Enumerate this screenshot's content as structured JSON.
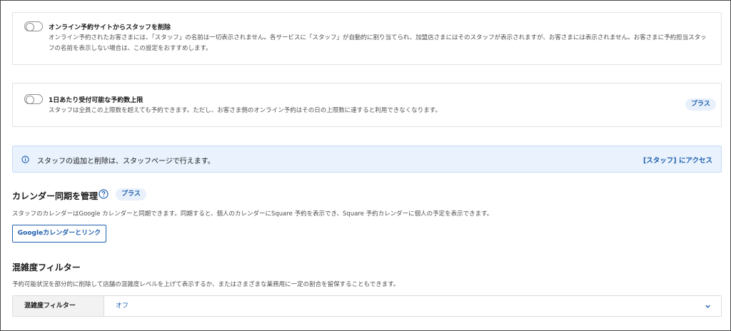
{
  "staff_removal": {
    "title": "オンライン予約サイトからスタッフを削除",
    "description": "オンライン予約されたお客さまには、「スタッフ」の名前は一切表示されません。各サービスに「スタッフ」が自動的に割り当てられ、加盟店さまにはそのスタッフが表示されますが、お客さまには表示されません。お客さまに予約担当スタッフの名前を表示しない場合は、この設定をおすすめします。"
  },
  "daily_limit": {
    "title": "1日あたり受付可能な予約数上限",
    "description": "スタッフは全員この上限数を超えても予約できます。ただし、お客さま側のオンライン予約はその日の上限数に達すると利用できなくなります。",
    "badge": "プラス"
  },
  "info_banner": {
    "text": "スタッフの追加と削除は、スタッフページで行えます。",
    "link": "[スタッフ] にアクセス"
  },
  "calendar_sync": {
    "title": "カレンダー同期を管理",
    "badge": "プラス",
    "description": "スタッフのカレンダーはGoogle カレンダーと同期できます。同期すると、個人のカレンダーにSquare 予約を表示でき、Square 予約カレンダーに個人の予定を表示できます。",
    "button": "Googleカレンダーとリンク"
  },
  "congestion_filter": {
    "title": "混雑度フィルター",
    "description": "予約可能状況を部分的に削除して店舗の混雑度レベルを上げて表示するか、またはさまざまな業務用に一定の割合を留保することもできます。",
    "label": "混雑度フィルター",
    "value": "オフ"
  },
  "colors": {
    "accent": "#1f5fae",
    "banner_bg": "#e9f2fd",
    "badge_bg": "#e8f0fb"
  },
  "icons": [
    "info-icon",
    "help-icon",
    "chevron-down-icon"
  ]
}
